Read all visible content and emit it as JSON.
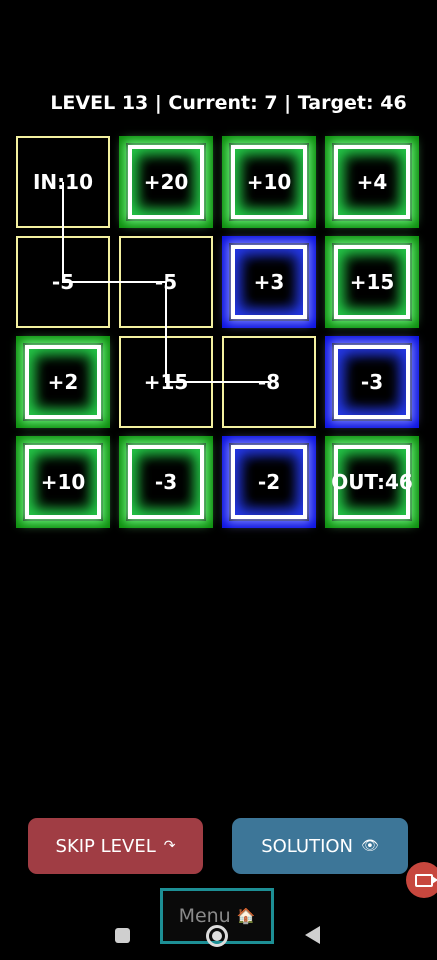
{
  "status_text": "LEVEL 13 | Current: 7 | Target: 46",
  "colors": {
    "path": "#f3f0a0",
    "green_frame": "#0c8c0c",
    "blue_frame": "#0a10e0",
    "skip": "#a03d44",
    "solution": "#3d7698",
    "menu_border": "#1d8f95"
  },
  "grid": {
    "rows": [
      [
        {
          "label": "IN:10",
          "kind": "path"
        },
        {
          "label": "+20",
          "kind": "green"
        },
        {
          "label": "+10",
          "kind": "green"
        },
        {
          "label": "+4",
          "kind": "green"
        }
      ],
      [
        {
          "label": "-5",
          "kind": "path"
        },
        {
          "label": "-5",
          "kind": "path"
        },
        {
          "label": "+3",
          "kind": "blue"
        },
        {
          "label": "+15",
          "kind": "green"
        }
      ],
      [
        {
          "label": "+2",
          "kind": "green"
        },
        {
          "label": "+15",
          "kind": "path"
        },
        {
          "label": "-8",
          "kind": "path"
        },
        {
          "label": "-3",
          "kind": "blue"
        }
      ],
      [
        {
          "label": "+10",
          "kind": "green"
        },
        {
          "label": "-3",
          "kind": "green"
        },
        {
          "label": "-2",
          "kind": "blue"
        },
        {
          "label": "OUT:46",
          "kind": "green"
        }
      ]
    ],
    "path": [
      [
        0,
        0
      ],
      [
        1,
        0
      ],
      [
        1,
        1
      ],
      [
        2,
        1
      ],
      [
        2,
        2
      ]
    ]
  },
  "buttons": {
    "skip": "SKIP LEVEL",
    "skip_icon": "redo-arrow-icon",
    "solution": "SOLUTION",
    "solution_icon": "eye-icon",
    "menu": "Menu",
    "menu_icon": "house-icon"
  }
}
